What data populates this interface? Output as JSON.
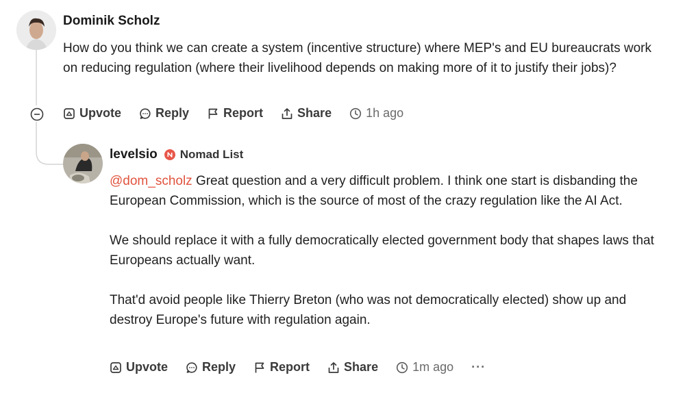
{
  "comment": {
    "author": "Dominik Scholz",
    "text": "How do you think we can create a system (incentive structure) where MEP's and EU bureaucrats work on reducing regulation (where their livelihood depends on making more of it to justify their jobs)?",
    "actions": {
      "upvote": "Upvote",
      "reply": "Reply",
      "report": "Report",
      "share": "Share"
    },
    "time": "1h ago"
  },
  "reply": {
    "author": "levelsio",
    "badge": "Nomad List",
    "mention": "@dom_scholz",
    "paragraph1": " Great question and a very difficult problem. I think one start is disbanding the European Commission, which is the source of most of the crazy regulation like the AI Act.",
    "paragraph2": "We should replace it with a fully democratically elected government body that shapes laws that Europeans actually want.",
    "paragraph3": "That'd avoid people like Thierry Breton (who was not democratically elected) show up and destroy Europe's future with regulation again.",
    "actions": {
      "upvote": "Upvote",
      "reply": "Reply",
      "report": "Report",
      "share": "Share",
      "more": "···"
    },
    "time": "1m ago"
  },
  "colors": {
    "mention": "#e0533e",
    "badge": "#e8574a",
    "thread_line": "#d4d4d4"
  }
}
